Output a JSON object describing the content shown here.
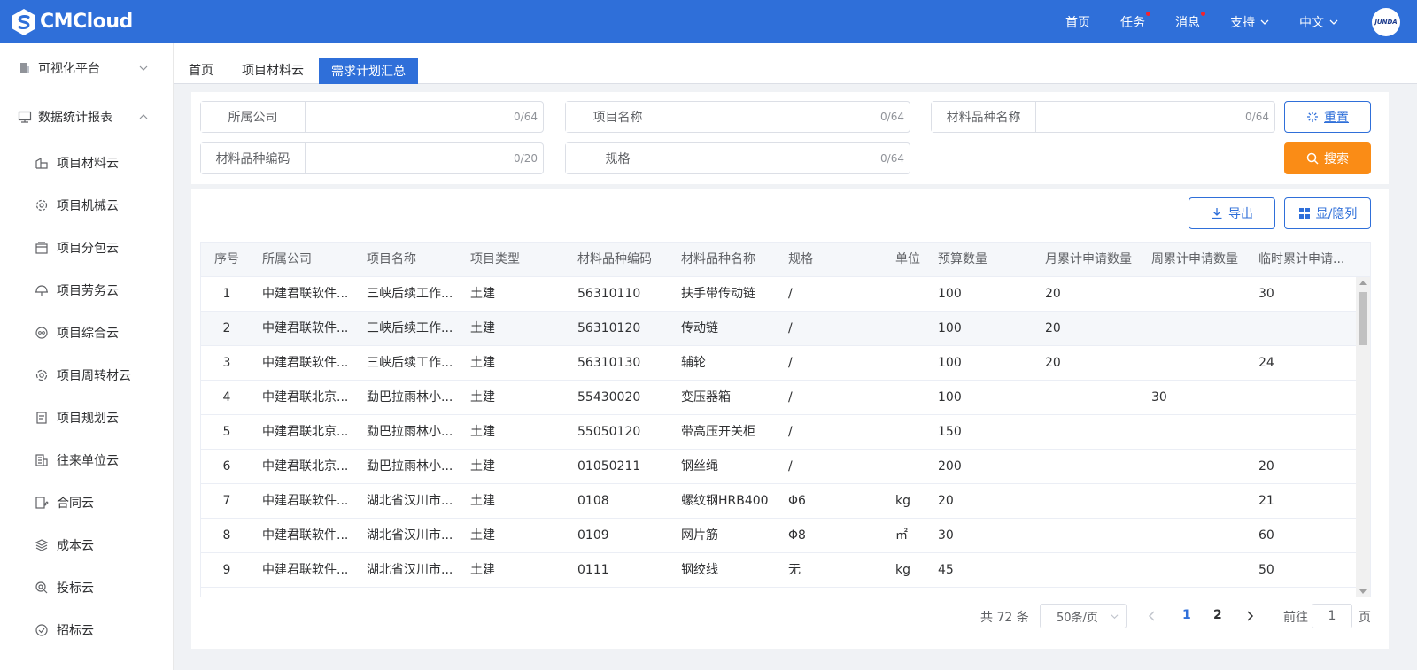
{
  "header": {
    "logo_text": "CMCloud",
    "nav": [
      {
        "label": "首页",
        "dot": false,
        "caret": false
      },
      {
        "label": "任务",
        "dot": true,
        "caret": false
      },
      {
        "label": "消息",
        "dot": true,
        "caret": false
      },
      {
        "label": "支持",
        "dot": false,
        "caret": true
      },
      {
        "label": "中文",
        "dot": false,
        "caret": true
      }
    ],
    "avatar_text": "JUNDA",
    "bg_color": "#2f6fd9"
  },
  "sidebar": {
    "groups": [
      {
        "label": "可视化平台",
        "icon": "building-icon",
        "expanded": false
      },
      {
        "label": "数据统计报表",
        "icon": "report-icon",
        "expanded": true
      }
    ],
    "items": [
      {
        "label": "项目材料云",
        "icon": "material-icon"
      },
      {
        "label": "项目机械云",
        "icon": "gear-icon"
      },
      {
        "label": "项目分包云",
        "icon": "package-icon"
      },
      {
        "label": "项目劳务云",
        "icon": "helmet-icon"
      },
      {
        "label": "项目综合云",
        "icon": "composite-icon"
      },
      {
        "label": "项目周转材云",
        "icon": "cycle-icon"
      },
      {
        "label": "项目规划云",
        "icon": "plan-icon"
      },
      {
        "label": "往来单位云",
        "icon": "company-icon"
      },
      {
        "label": "合同云",
        "icon": "contract-icon"
      },
      {
        "label": "成本云",
        "icon": "layers-icon"
      },
      {
        "label": "投标云",
        "icon": "bid-icon"
      },
      {
        "label": "招标云",
        "icon": "tender-icon"
      }
    ]
  },
  "tabs": [
    {
      "label": "首页",
      "active": false
    },
    {
      "label": "项目材料云",
      "active": false
    },
    {
      "label": "需求计划汇总",
      "active": true
    }
  ],
  "search": {
    "fields": [
      {
        "label": "所属公司",
        "value": "",
        "count": "0/64"
      },
      {
        "label": "项目名称",
        "value": "",
        "count": "0/64"
      },
      {
        "label": "材料品种名称",
        "value": "",
        "count": "0/64"
      },
      {
        "label": "材料品种编码",
        "value": "",
        "count": "0/20"
      },
      {
        "label": "规格",
        "value": "",
        "count": "0/64"
      }
    ],
    "reset_label": "重置",
    "search_label": "搜索"
  },
  "toolbar": {
    "export_label": "导出",
    "columns_label": "显/隐列"
  },
  "table": {
    "columns": [
      "序号",
      "所属公司",
      "项目名称",
      "项目类型",
      "材料品种编码",
      "材料品种名称",
      "规格",
      "单位",
      "预算数量",
      "月累计申请数量",
      "周累计申请数量",
      "临时累计申请..."
    ],
    "rows": [
      [
        "1",
        "中建君联软件...",
        "三峡后续工作...",
        "土建",
        "56310110",
        "扶手带传动链",
        "/",
        "",
        "100",
        "20",
        "",
        "30"
      ],
      [
        "2",
        "中建君联软件...",
        "三峡后续工作...",
        "土建",
        "56310120",
        "传动链",
        "/",
        "",
        "100",
        "20",
        "",
        ""
      ],
      [
        "3",
        "中建君联软件...",
        "三峡后续工作...",
        "土建",
        "56310130",
        "辅轮",
        "/",
        "",
        "100",
        "20",
        "",
        "24"
      ],
      [
        "4",
        "中建君联北京...",
        "勐巴拉雨林小...",
        "土建",
        "55430020",
        "变压器箱",
        "/",
        "",
        "100",
        "",
        "30",
        ""
      ],
      [
        "5",
        "中建君联北京...",
        "勐巴拉雨林小...",
        "土建",
        "55050120",
        "带高压开关柜",
        "/",
        "",
        "150",
        "",
        "",
        ""
      ],
      [
        "6",
        "中建君联北京...",
        "勐巴拉雨林小...",
        "土建",
        "01050211",
        "钢丝绳",
        "/",
        "",
        "200",
        "",
        "",
        "20"
      ],
      [
        "7",
        "中建君联软件...",
        "湖北省汉川市...",
        "土建",
        "0108",
        "螺纹钢HRB400",
        "Φ6",
        "kg",
        "20",
        "",
        "",
        "21"
      ],
      [
        "8",
        "中建君联软件...",
        "湖北省汉川市...",
        "土建",
        "0109",
        "网片筋",
        "Φ8",
        "㎡",
        "30",
        "",
        "",
        "60"
      ],
      [
        "9",
        "中建君联软件...",
        "湖北省汉川市...",
        "土建",
        "0111",
        "钢绞线",
        "无",
        "kg",
        "45",
        "",
        "",
        "50"
      ]
    ]
  },
  "pagination": {
    "total_text": "共 72 条",
    "page_size": "50条/页",
    "pages": [
      "1",
      "2"
    ],
    "current_page": "1",
    "goto_label": "前往",
    "goto_value": "1",
    "page_unit": "页"
  }
}
